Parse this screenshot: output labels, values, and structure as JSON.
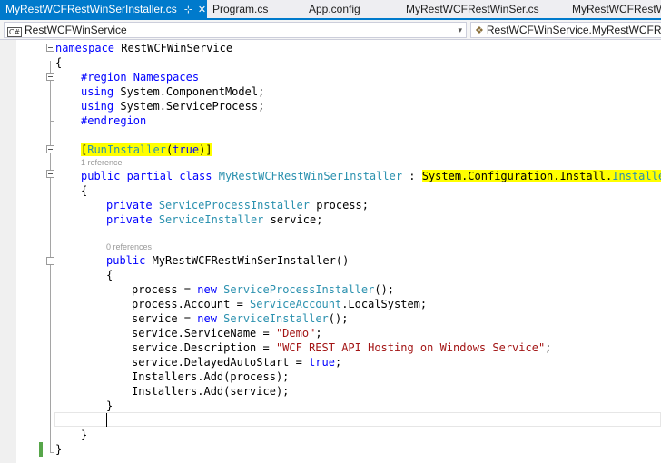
{
  "tabs": [
    {
      "label": "MyRestWCFRestWinSerInstaller.cs",
      "active": true,
      "pin_glyph": "⊹",
      "close_glyph": "✕"
    },
    {
      "label": "Program.cs"
    },
    {
      "label": "App.config"
    },
    {
      "label": "MyRestWCFRestWinSer.cs"
    },
    {
      "label": "MyRestWCFRestWi"
    }
  ],
  "navbar": {
    "project_icon": "C#",
    "project_combo": "RestWCFWinService",
    "type_combo": "RestWCFWinService.MyRestWCFRes",
    "dropdown_glyph": "▾",
    "class_icon_glyph": "❖"
  },
  "code": {
    "line_namespace": {
      "kw": "namespace",
      "name": " RestWCFWinService"
    },
    "brace_ns_open": "{",
    "line_region": "#region Namespaces",
    "line_using1": {
      "kw": "using",
      "rest": " System.ComponentModel;"
    },
    "line_using2": {
      "kw": "using",
      "rest": " System.ServiceProcess;"
    },
    "line_endregion": "#endregion",
    "line_attr": {
      "open": "[",
      "type": "RunInstaller",
      "open_paren": "(",
      "kw": "true",
      "close": ")]"
    },
    "lens_class": "1 reference",
    "line_class": {
      "kw1": "public",
      "kw2": " partial",
      "kw3": " class",
      "sp": " ",
      "name": "MyRestWCFRestWinSerInstaller",
      "colon": " : ",
      "base_ns": "System.Configuration.Install.",
      "base_type": "Installer"
    },
    "brace_class_open": "{",
    "line_field1": {
      "kw": "private",
      "sp": " ",
      "type": "ServiceProcessInstaller",
      "rest": " process;"
    },
    "line_field2": {
      "kw": "private",
      "sp": " ",
      "type": "ServiceInstaller",
      "rest": " service;"
    },
    "lens_ctor": "0 references",
    "line_ctor": {
      "kw": "public",
      "rest": " MyRestWCFRestWinSerInstaller()"
    },
    "brace_ctor_open": "{",
    "line_s1": {
      "pre": "process = ",
      "kw": "new",
      "sp": " ",
      "type": "ServiceProcessInstaller",
      "post": "();"
    },
    "line_s2": {
      "pre": "process.Account = ",
      "type": "ServiceAccount",
      "post": ".LocalSystem;"
    },
    "line_s3": {
      "pre": "service = ",
      "kw": "new",
      "sp": " ",
      "type": "ServiceInstaller",
      "post": "();"
    },
    "line_s4": {
      "pre": "service.ServiceName = ",
      "str": "\"Demo\"",
      "post": ";"
    },
    "line_s5": {
      "pre": "service.Description = ",
      "str": "\"WCF REST API Hosting on Windows Service\"",
      "post": ";"
    },
    "line_s6": {
      "pre": "service.DelayedAutoStart = ",
      "kw": "true",
      "post": ";"
    },
    "line_s7": "Installers.Add(process);",
    "line_s8": "Installers.Add(service);",
    "brace_ctor_close": "}",
    "brace_class_close": "}",
    "brace_ns_close": "}"
  },
  "colors": {
    "accent": "#007acc",
    "keyword": "#0000ff",
    "type": "#2b91af",
    "string": "#a31515",
    "highlight": "#ffff00",
    "change_bar": "#57a64a"
  }
}
